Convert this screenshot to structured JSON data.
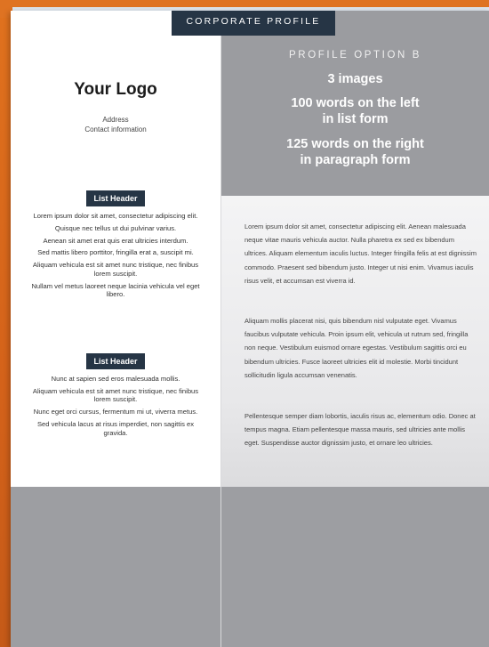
{
  "tab_label": "CORPORATE PROFILE",
  "logo": "Your Logo",
  "address": "Address",
  "contact": "Contact information",
  "lists": [
    {
      "header": "List Header",
      "items": [
        "Lorem ipsum dolor sit amet, consectetur adipiscing elit.",
        "Quisque nec tellus ut dui pulvinar varius.",
        "Aenean sit amet erat quis erat ultricies interdum.",
        "Sed mattis libero porttitor, fringilla erat a, suscipit mi.",
        "Aliquam vehicula est sit amet nunc tristique, nec finibus lorem suscipit.",
        "Nullam vel metus laoreet neque lacinia vehicula vel eget libero."
      ]
    },
    {
      "header": "List Header",
      "items": [
        "Nunc at sapien sed eros malesuada mollis.",
        "Aliquam vehicula est sit amet nunc tristique, nec finibus lorem suscipit.",
        "Nunc eget orci cursus, fermentum mi ut, viverra metus.",
        "Sed vehicula lacus at risus imperdiet, non sagittis ex gravida."
      ]
    }
  ],
  "option": {
    "title": "PROFILE OPTION B",
    "line1": "3 images",
    "line2a": "100 words on the left",
    "line2b": "in list form",
    "line3a": "125 words on the right",
    "line3b": "in paragraph form"
  },
  "paragraphs": [
    "Lorem ipsum dolor sit amet, consectetur adipiscing elit. Aenean malesuada neque vitae mauris vehicula auctor. Nulla pharetra ex sed ex bibendum ultrices. Aliquam elementum iaculis luctus. Integer fringilla felis at est dignissim commodo. Praesent sed bibendum justo. Integer ut nisi enim. Vivamus iaculis risus velit, et accumsan est viverra id.",
    "Aliquam mollis placerat nisi, quis bibendum nisl vulputate eget. Vivamus faucibus vulputate vehicula. Proin ipsum elit, vehicula ut rutrum sed, fringilla non neque. Vestibulum euismod ornare egestas. Vestibulum sagittis orci eu bibendum ultricies. Fusce laoreet ultricies elit id molestie. Morbi tincidunt sollicitudin ligula accumsan venenatis.",
    "Pellentesque semper diam lobortis, iaculis risus ac, elementum odio. Donec at tempus magna. Etiam pellentesque massa mauris, sed ultricies ante mollis eget. Suspendisse auctor dignissim justo, et ornare leo ultricies."
  ]
}
